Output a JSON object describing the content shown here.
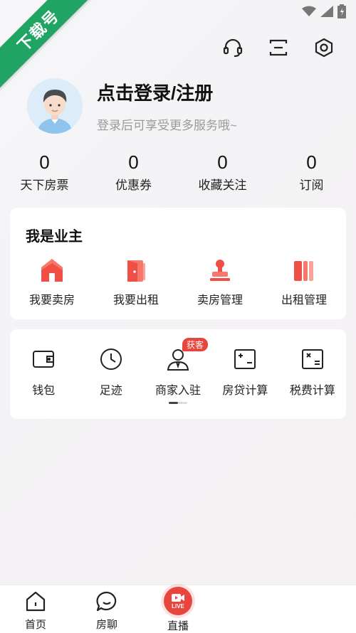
{
  "watermark": {
    "text": "下载号",
    "color": "#1fa463"
  },
  "status_bar": {
    "icons": [
      "wifi-icon",
      "signal-icon",
      "battery-icon"
    ]
  },
  "header_actions": {
    "icons": [
      "headset-icon",
      "scan-icon",
      "settings-icon"
    ]
  },
  "profile": {
    "title": "点击登录/注册",
    "subtitle": "登录后可享受更多服务哦~"
  },
  "stats": [
    {
      "value": "0",
      "label": "天下房票"
    },
    {
      "value": "0",
      "label": "优惠券"
    },
    {
      "value": "0",
      "label": "收藏关注"
    },
    {
      "value": "0",
      "label": "订阅"
    }
  ],
  "owner_section": {
    "title": "我是业主",
    "items": [
      {
        "label": "我要卖房",
        "icon": "house-icon"
      },
      {
        "label": "我要出租",
        "icon": "door-icon"
      },
      {
        "label": "卖房管理",
        "icon": "stamp-icon"
      },
      {
        "label": "出租管理",
        "icon": "books-icon"
      }
    ]
  },
  "tools": {
    "items": [
      {
        "label": "钱包",
        "icon": "wallet-icon"
      },
      {
        "label": "足迹",
        "icon": "clock-icon"
      },
      {
        "label": "商家入驻",
        "icon": "merchant-icon",
        "badge": "获客"
      },
      {
        "label": "房贷计算",
        "icon": "calculator-icon"
      },
      {
        "label": "税费计算",
        "icon": "tax-calculator-icon"
      }
    ],
    "page_indicator": {
      "current": 1,
      "total": 2
    }
  },
  "bottom_nav": [
    {
      "label": "首页",
      "icon": "home-icon"
    },
    {
      "label": "房聊",
      "icon": "chat-icon"
    },
    {
      "label": "直播",
      "icon": "live-icon",
      "badge_text": "LIVE"
    }
  ],
  "colors": {
    "accent": "#e8453c",
    "background": "#f5f5f7"
  }
}
